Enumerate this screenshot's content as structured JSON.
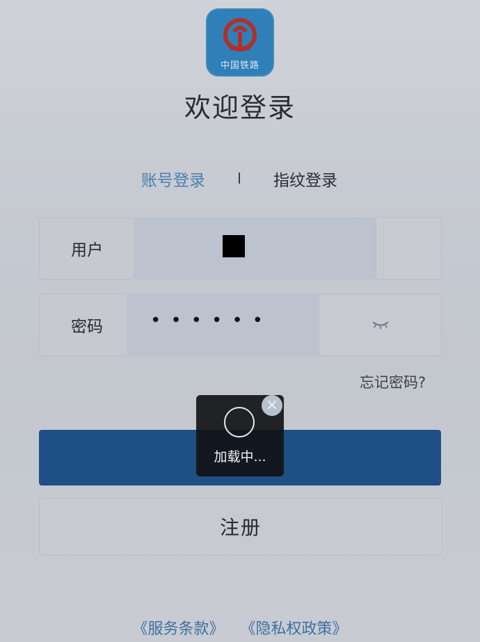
{
  "header": {
    "logo_text": "中国铁路",
    "welcome": "欢迎登录"
  },
  "tabs": {
    "account": "账号登录",
    "fingerprint": "指纹登录",
    "active": "account"
  },
  "form": {
    "user_label": "用户",
    "password_label": "密码",
    "password_mask": "••••••",
    "forgot": "忘记密码?"
  },
  "buttons": {
    "login": "",
    "register": "注册"
  },
  "loading": {
    "text": "加载中...",
    "close_symbol": "×"
  },
  "footer": {
    "terms": "《服务条款》",
    "privacy": "《隐私权政策》"
  },
  "colors": {
    "accent": "#1e4f85",
    "tab_active": "#4a7fb0",
    "footer_link": "#3f6fa3",
    "logo_bg": "#2f7fb8"
  },
  "icons": [
    "railway-logo-icon",
    "eye-closed-icon",
    "spinner-icon",
    "close-icon"
  ]
}
